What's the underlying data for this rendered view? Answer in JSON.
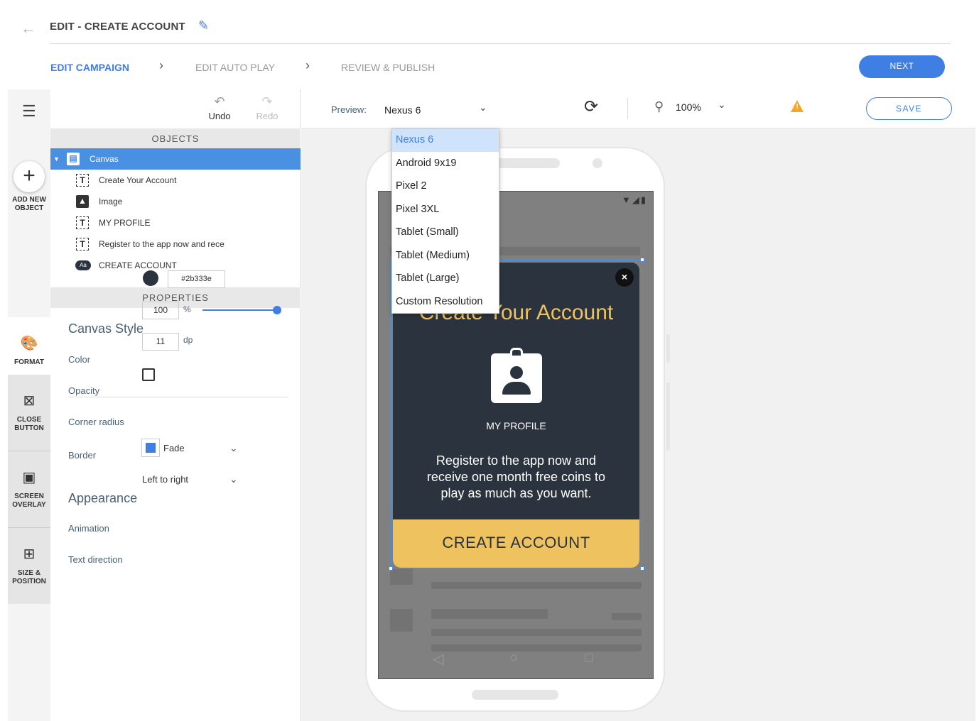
{
  "header": {
    "title": "EDIT - CREATE ACCOUNT",
    "steps": [
      "EDIT CAMPAIGN",
      "EDIT AUTO PLAY",
      "REVIEW & PUBLISH"
    ],
    "next_label": "NEXT"
  },
  "rail": {
    "add_label": "ADD NEW OBJECT",
    "buttons": [
      "FORMAT",
      "CLOSE BUTTON",
      "SCREEN OVERLAY",
      "SIZE & POSITION"
    ]
  },
  "objects": {
    "undo": "Undo",
    "redo": "Redo",
    "header": "OBJECTS",
    "items": [
      "Canvas",
      "Create Your Account",
      "Image",
      "MY PROFILE",
      "Register to the app now and rece",
      "CREATE ACCOUNT"
    ]
  },
  "properties": {
    "header": "PROPERTIES",
    "canvas_style": "Canvas Style",
    "color_label": "Color",
    "color_hex": "#2b333e",
    "opacity_label": "Opacity",
    "opacity_value": "100",
    "opacity_unit": "%",
    "opacity_level": 1.0,
    "corner_label": "Corner radius",
    "corner_value": "11",
    "corner_unit": "dp",
    "border_label": "Border",
    "appearance": "Appearance",
    "animation_label": "Animation",
    "animation_value": "Fade",
    "text_direction_label": "Text direction",
    "text_direction_value": "Left to right"
  },
  "toolbar": {
    "preview_label": "Preview:",
    "preview_value": "Nexus 6",
    "zoom_value": "100%",
    "save_label": "SAVE"
  },
  "dropdown": {
    "options": [
      "Nexus 6",
      "Android 9x19",
      "Pixel 2",
      "Pixel 3XL",
      "Tablet (Small)",
      "Tablet (Medium)",
      "Tablet (Large)",
      "Custom Resolution"
    ],
    "selected": "Nexus 6"
  },
  "modal": {
    "title": "Create Your Account",
    "close": "×",
    "profile_label": "MY PROFILE",
    "body": "Register to the app now and receive one month free coins to play as much as you want.",
    "cta": "CREATE ACCOUNT"
  },
  "colors": {
    "accent": "#3f7fe3",
    "canvas": "#2b333e",
    "gold": "#efc260",
    "warning": "#f5a623"
  }
}
